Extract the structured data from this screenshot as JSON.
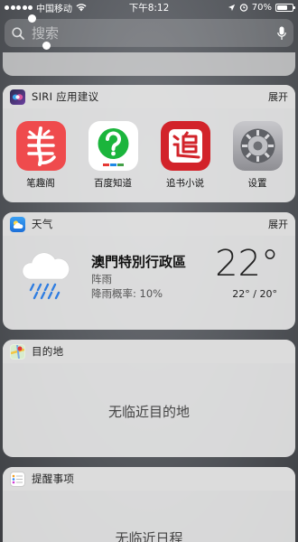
{
  "status_bar": {
    "carrier": "中国移动",
    "time": "下午8:12",
    "battery": "70%",
    "battery_level": 0.7
  },
  "search": {
    "placeholder": "搜索"
  },
  "siri": {
    "title": "SIRI 应用建议",
    "action": "展开",
    "apps": [
      {
        "label": "笔趣阁",
        "icon": "biquge-app-icon"
      },
      {
        "label": "百度知道",
        "icon": "baidu-zhidao-app-icon"
      },
      {
        "label": "追书小说",
        "icon": "zhuishu-app-icon"
      },
      {
        "label": "设置",
        "icon": "settings-gear-icon"
      }
    ]
  },
  "weather": {
    "title": "天气",
    "action": "展开",
    "city": "澳門特別行政區",
    "condition": "阵雨",
    "rain_chance": "降雨概率: 10%",
    "temp": "22°",
    "range": "22° / 20°"
  },
  "destinations": {
    "title": "目的地",
    "empty": "无临近目的地"
  },
  "reminders": {
    "title": "提醒事项",
    "empty": "无临近日程"
  },
  "colors": {
    "biquge_red": "#ef4b4d",
    "zhuishu_red": "#d2232a",
    "baidu_green": "#1bb53c"
  }
}
